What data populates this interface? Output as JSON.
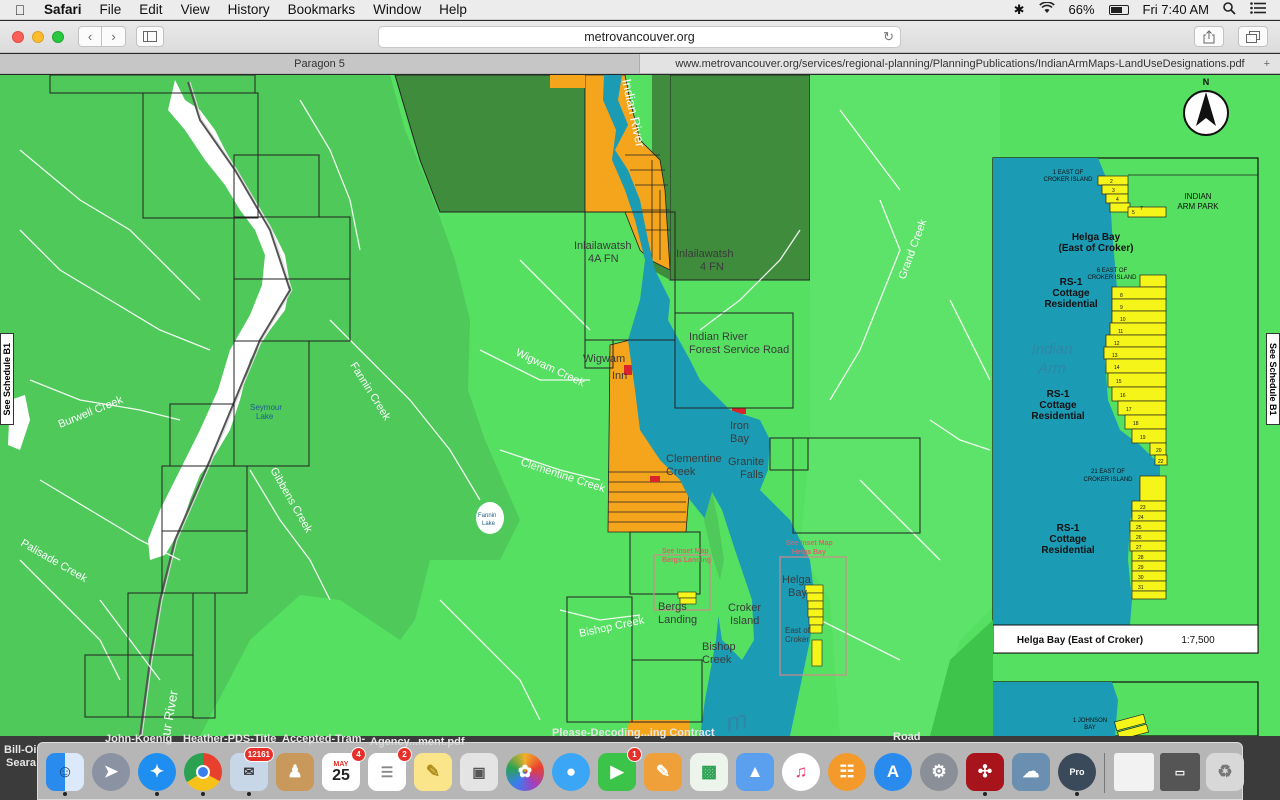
{
  "menubar": {
    "app_name": "Safari",
    "items": [
      "File",
      "Edit",
      "View",
      "History",
      "Bookmarks",
      "Window",
      "Help"
    ],
    "battery": "66%",
    "clock": "Fri 7:40 AM"
  },
  "toolbar": {
    "address": "metrovancouver.org"
  },
  "tabs": [
    {
      "title": "Paragon 5"
    },
    {
      "title": "www.metrovancouver.org/services/regional-planning/PlanningPublications/IndianArmMaps-LandUseDesignations.pdf"
    }
  ],
  "map": {
    "side_tab_left": "See Schedule B1",
    "side_tab_right": "See Schedule B1",
    "north": "N",
    "rivers": {
      "indian_river_top": "Indian River",
      "seymour_river_bottom": "ur River"
    },
    "creeks": {
      "burwell": "Burwell Creek",
      "fannin": "Fannin Creek",
      "gibbens": "Gibbens Creek",
      "palisade": "Palisade Creek",
      "wigwam": "Wigwam Creek",
      "clementine": "Clementine Creek",
      "grand": "Grand Creek",
      "bishop": "Bishop Creek"
    },
    "lakes": {
      "seymour_line1": "Seymour",
      "seymour_line2": "Lake",
      "fannin_line1": "Fannin",
      "fannin_line2": "Lake"
    },
    "places": {
      "inlailawatsh_4a_line1": "Inlailawatsh",
      "inlailawatsh_4a_line2": "4A FN",
      "inlailawatsh_4_line1": "Inlailawatsh",
      "inlailawatsh_4_line2": "4 FN",
      "forest_road_line1": "Indian River",
      "forest_road_line2": "Forest Service Road",
      "wigwam_inn_line1": "Wigwam",
      "wigwam_inn_line2": "Inn",
      "iron_bay_line1": "Iron",
      "iron_bay_line2": "Bay",
      "clementine_line1": "Clementine",
      "clementine_line2": "Creek",
      "granite_line1": "Granite",
      "granite_line2": "Falls",
      "bergs_line1": "Bergs",
      "bergs_line2": "Landing",
      "croker_line1": "Croker",
      "croker_line2": "Island",
      "bishop_line1": "Bishop",
      "bishop_line2": "Creek",
      "helga_line1": "Helga",
      "helga_line2": "Bay",
      "east_line1": "East of",
      "east_line2": "Croker",
      "arm_big": "m"
    },
    "inset_refs": {
      "bergs_line1": "See Inset Map",
      "bergs_line2": "Bergs Landing",
      "helga_line1": "See Inset Map",
      "helga_line2": "Helga Bay"
    },
    "inset": {
      "label_1_east_line1": "1 EAST OF",
      "label_1_east_line2": "CROKER ISLAND",
      "park_line1": "INDIAN",
      "park_line2": "ARM PARK",
      "helga_line1": "Helga Bay",
      "helga_line2": "(East of Croker)",
      "label_6_east_line1": "6 EAST OF",
      "label_6_east_line2": "CROKER ISLAND",
      "indian_arm_line1": "Indian",
      "indian_arm_line2": "Arm",
      "rs1_code": "RS-1",
      "rs1_line2": "Cottage",
      "rs1_line3": "Residential",
      "label_21_east_line1": "21 EAST OF",
      "label_21_east_line2": "CROKER ISLAND",
      "title": "Helga Bay (East of Croker)",
      "scale": "1:7,500",
      "johnson_line1": "1 JOHNSON",
      "johnson_line2": "BAY",
      "lot_numbers": [
        "2",
        "3",
        "4",
        "5",
        "7",
        "8",
        "9",
        "10",
        "11",
        "12",
        "13",
        "14",
        "15",
        "16",
        "17",
        "18",
        "19",
        "20",
        "22",
        "23",
        "24",
        "25",
        "26",
        "27",
        "28",
        "29",
        "30",
        "31"
      ]
    }
  },
  "desktop": {
    "left_line1": "Bill-Oi",
    "left_line2": "Seara",
    "files": [
      "John-Koenig",
      "Heather-PDS-Title",
      "Accepted-Tram-",
      "Agency...ment.pdf",
      "Please-Decoding...ing Contract",
      "Road"
    ]
  },
  "dock": {
    "calendar_month": "MAY",
    "calendar_day": "25",
    "badges": {
      "photos_app": "12161",
      "calendar": "4",
      "reminders": "2",
      "facetime": "1"
    },
    "pro_label": "Pro"
  }
}
